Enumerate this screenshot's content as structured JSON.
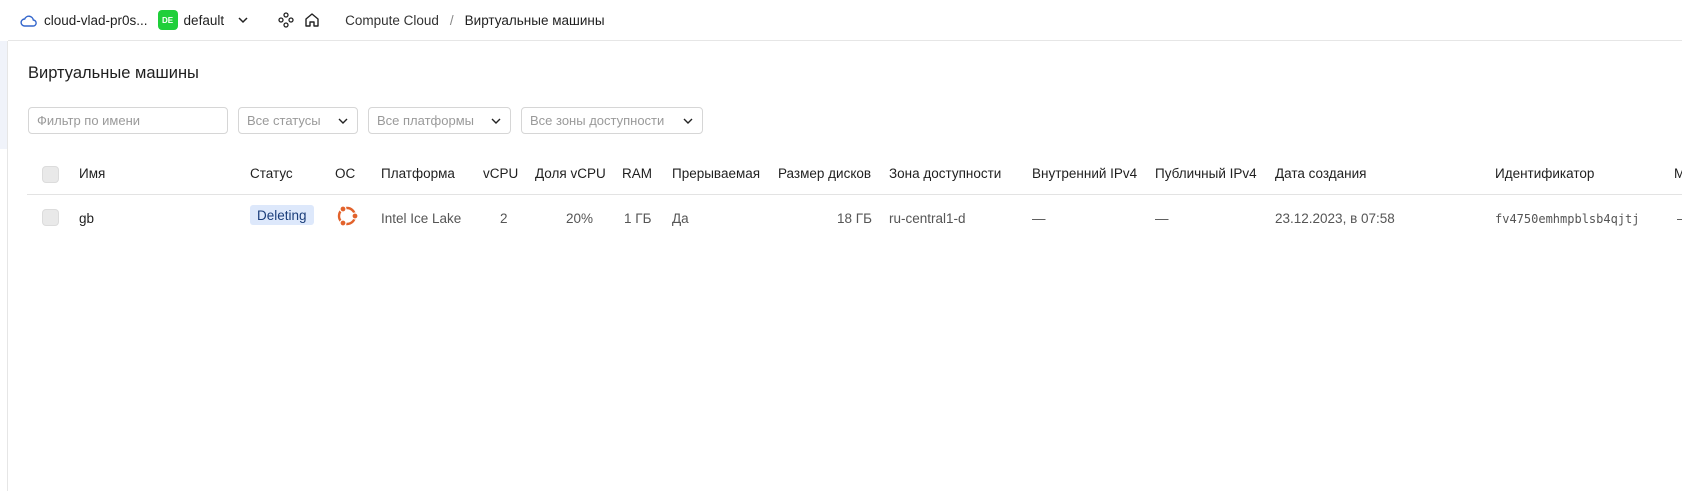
{
  "header": {
    "cloud_name": "cloud-vlad-pr0s...",
    "folder_badge": "DE",
    "folder_name": "default",
    "breadcrumbs": [
      "Compute Cloud",
      "Виртуальные машины"
    ],
    "breadcrumb_separator": "/",
    "accent_color": "#1fcf3a"
  },
  "page": {
    "title": "Виртуальные машины"
  },
  "filters": {
    "name_placeholder": "Фильтр по имени",
    "status_select": "Все статусы",
    "platform_select": "Все платформы",
    "zone_select": "Все зоны доступности"
  },
  "table": {
    "columns": [
      "Имя",
      "Статус",
      "ОС",
      "Платформа",
      "vCPU",
      "Доля vCPU",
      "RAM",
      "Прерываемая",
      "Размер дисков",
      "Зона доступности",
      "Внутренний IPv4",
      "Публичный IPv4",
      "Дата создания",
      "Идентификатор",
      "М"
    ],
    "rows": [
      {
        "name": "gb",
        "status": "Deleting",
        "os_icon": "ubuntu-icon",
        "platform": "Intel Ice Lake",
        "vcpu": "2",
        "vcpu_share": "20%",
        "ram": "1 ГБ",
        "preemptible": "Да",
        "disk_size": "18 ГБ",
        "zone": "ru-central1-d",
        "internal_ipv4": "—",
        "public_ipv4": "—",
        "created": "23.12.2023, в 07:58",
        "id": "fv4750emhmpblsb4qjtj",
        "extra": "–"
      }
    ]
  }
}
